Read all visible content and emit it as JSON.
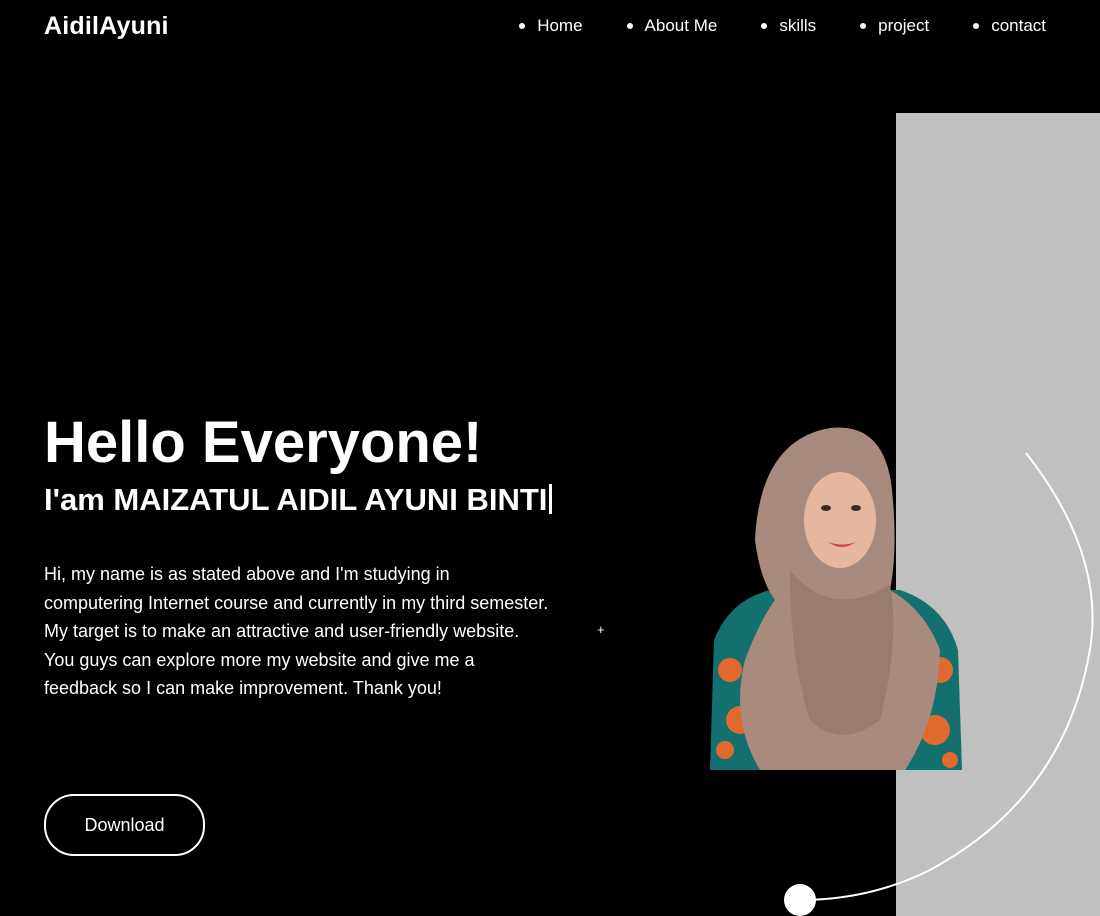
{
  "header": {
    "logo": "AidilAyuni",
    "nav": [
      {
        "label": "Home"
      },
      {
        "label": "About Me"
      },
      {
        "label": "skills"
      },
      {
        "label": "project"
      },
      {
        "label": "contact"
      }
    ]
  },
  "hero": {
    "title": "Hello Everyone!",
    "subtitle": "I'am MAIZATUL AIDIL AYUNI BINTI",
    "description": "Hi, my name is as stated above and I'm studying in computering Internet course and currently in my third semester. My target is to make an attractive and user-friendly website. You guys can explore more my website and give me a feedback so I can make improvement. Thank you!",
    "download_label": "Download",
    "plus": "+"
  },
  "colors": {
    "background": "#000000",
    "panel": "#c0c0c0",
    "text": "#ffffff"
  }
}
